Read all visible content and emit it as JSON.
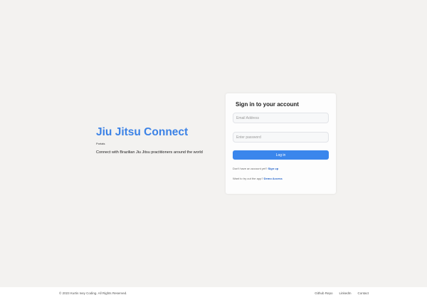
{
  "hero": {
    "title": "Jiu Jitsu Connect",
    "subtitle": "Portals",
    "description": "Connect with Brazilian Jiu Jitsu practitioners around the world"
  },
  "login": {
    "heading": "Sign in to your account",
    "email_placeholder": "Email Address",
    "password_placeholder": "Enter password",
    "login_label": "Log in",
    "signup_prompt": "Don't have an account yet?",
    "signup_link": "Sign up",
    "demo_prompt": "Want to try out the app?",
    "demo_link": "Demo Access"
  },
  "footer": {
    "copyright": "© 2023 Kurtis Ivey Coding. All Rights Reserved.",
    "links": [
      "Github Repo",
      "LinkedIn",
      "Contact"
    ]
  }
}
